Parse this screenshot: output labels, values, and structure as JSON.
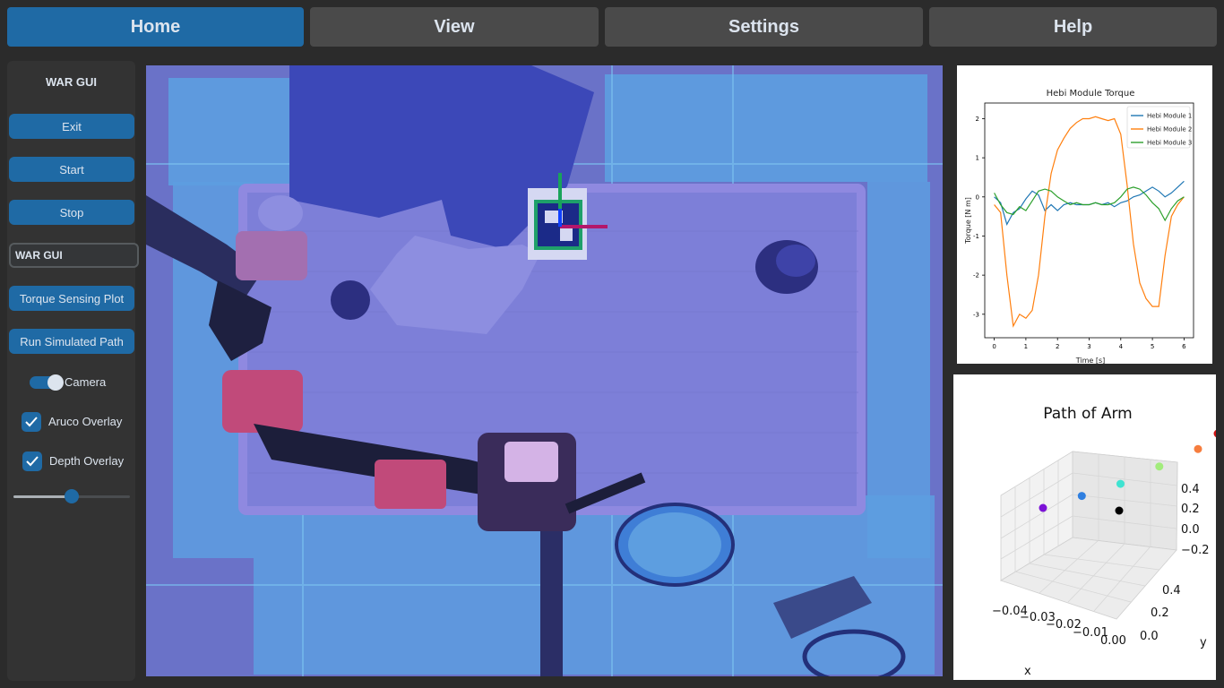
{
  "tabs": [
    {
      "label": "Home",
      "active": true
    },
    {
      "label": "View",
      "active": false
    },
    {
      "label": "Settings",
      "active": false
    },
    {
      "label": "Help",
      "active": false
    }
  ],
  "sidebar": {
    "title": "WAR GUI",
    "exit_label": "Exit",
    "start_label": "Start",
    "stop_label": "Stop",
    "entry_value": "WAR GUI",
    "torque_plot_label": "Torque Sensing Plot",
    "sim_path_label": "Run Simulated Path",
    "camera_switch": {
      "label": "Camera",
      "on": true
    },
    "aruco_overlay": {
      "label": "Aruco Overlay",
      "checked": true
    },
    "depth_overlay": {
      "label": "Depth Overlay",
      "checked": true
    },
    "slider_value": 0.5
  },
  "colors": {
    "accent": "#1f6aa5",
    "background": "#2b2b2b",
    "panel": "#333333",
    "tab_inactive": "#4a4a4a",
    "text": "#dce4ee"
  },
  "camera": {
    "icon": "camera-feed",
    "overlay": "depth-and-aruco"
  },
  "chart_data": [
    {
      "type": "line",
      "title": "Hebi Module Torque",
      "xlabel": "Time [s]",
      "ylabel": "Torque [N m]",
      "xlim": [
        -0.3,
        6.3
      ],
      "ylim": [
        -3.6,
        2.4
      ],
      "xticks": [
        "0",
        "1",
        "2",
        "3",
        "4",
        "5",
        "6"
      ],
      "yticks": [
        "2",
        "1",
        "0",
        "-1",
        "-2",
        "-3"
      ],
      "legend": "top-right",
      "series": [
        {
          "name": "Hebi Module 1",
          "color": "#1f77b4",
          "x": [
            0,
            0.2,
            0.4,
            0.6,
            0.8,
            1.0,
            1.2,
            1.4,
            1.6,
            1.8,
            2.0,
            2.2,
            2.4,
            2.6,
            2.8,
            3.0,
            3.2,
            3.4,
            3.6,
            3.8,
            4.0,
            4.2,
            4.4,
            4.6,
            4.8,
            5.0,
            5.2,
            5.4,
            5.6,
            5.8,
            6.0
          ],
          "values": [
            0.0,
            -0.15,
            -0.7,
            -0.4,
            -0.3,
            -0.05,
            0.15,
            0.05,
            -0.35,
            -0.2,
            -0.35,
            -0.2,
            -0.15,
            -0.2,
            -0.2,
            -0.2,
            -0.15,
            -0.2,
            -0.15,
            -0.25,
            -0.15,
            -0.1,
            0.0,
            0.05,
            0.15,
            0.25,
            0.15,
            0.0,
            0.1,
            0.25,
            0.4
          ]
        },
        {
          "name": "Hebi Module 2",
          "color": "#ff7f0e",
          "x": [
            0,
            0.2,
            0.4,
            0.6,
            0.8,
            1.0,
            1.2,
            1.4,
            1.6,
            1.8,
            2.0,
            2.2,
            2.4,
            2.6,
            2.8,
            3.0,
            3.2,
            3.4,
            3.6,
            3.8,
            4.0,
            4.2,
            4.4,
            4.6,
            4.8,
            5.0,
            5.2,
            5.4,
            5.6,
            5.8,
            6.0
          ],
          "values": [
            -0.2,
            -0.4,
            -2.0,
            -3.3,
            -3.0,
            -3.1,
            -2.9,
            -2.0,
            -0.5,
            0.6,
            1.2,
            1.5,
            1.75,
            1.9,
            2.0,
            2.0,
            2.05,
            2.0,
            1.95,
            2.0,
            1.6,
            0.3,
            -1.2,
            -2.2,
            -2.6,
            -2.8,
            -2.8,
            -1.5,
            -0.5,
            -0.2,
            0.0
          ]
        },
        {
          "name": "Hebi Module 3",
          "color": "#2ca02c",
          "x": [
            0,
            0.2,
            0.4,
            0.6,
            0.8,
            1.0,
            1.2,
            1.4,
            1.6,
            1.8,
            2.0,
            2.2,
            2.4,
            2.6,
            2.8,
            3.0,
            3.2,
            3.4,
            3.6,
            3.8,
            4.0,
            4.2,
            4.4,
            4.6,
            4.8,
            5.0,
            5.2,
            5.4,
            5.6,
            5.8,
            6.0
          ],
          "values": [
            0.1,
            -0.2,
            -0.4,
            -0.45,
            -0.25,
            -0.35,
            -0.1,
            0.15,
            0.2,
            0.15,
            0.0,
            -0.1,
            -0.2,
            -0.15,
            -0.2,
            -0.2,
            -0.15,
            -0.2,
            -0.2,
            -0.15,
            0.0,
            0.2,
            0.25,
            0.2,
            0.05,
            -0.15,
            -0.3,
            -0.6,
            -0.3,
            -0.1,
            0.0
          ]
        }
      ]
    },
    {
      "type": "scatter",
      "title": "Path of Arm",
      "xlabel": "x",
      "ylabel": "y",
      "xticks": [
        "−0.04",
        "−0.03",
        "−0.02",
        "−0.01",
        "0.00"
      ],
      "yticks": [
        "0.0",
        "0.2",
        "0.4"
      ],
      "zticks": [
        "0.4",
        "0.2",
        "0.0",
        "−0.2"
      ],
      "points": [
        {
          "x": -0.04,
          "y": 0.0,
          "z": 0.0,
          "color": "#7b12d6"
        },
        {
          "x": -0.03,
          "y": 0.1,
          "z": 0.05,
          "color": "#2f7fe0"
        },
        {
          "x": -0.02,
          "y": 0.2,
          "z": 0.1,
          "color": "#3fe3d1"
        },
        {
          "x": -0.01,
          "y": 0.3,
          "z": 0.2,
          "color": "#a2ec7c"
        },
        {
          "x": 0.0,
          "y": 0.4,
          "z": 0.3,
          "color": "#f67d3e"
        },
        {
          "x": 0.0,
          "y": 0.5,
          "z": 0.45,
          "color": "#d01212"
        },
        {
          "x": 0.0,
          "y": 0.0,
          "z": -0.3,
          "color": "#000000"
        }
      ]
    }
  ]
}
